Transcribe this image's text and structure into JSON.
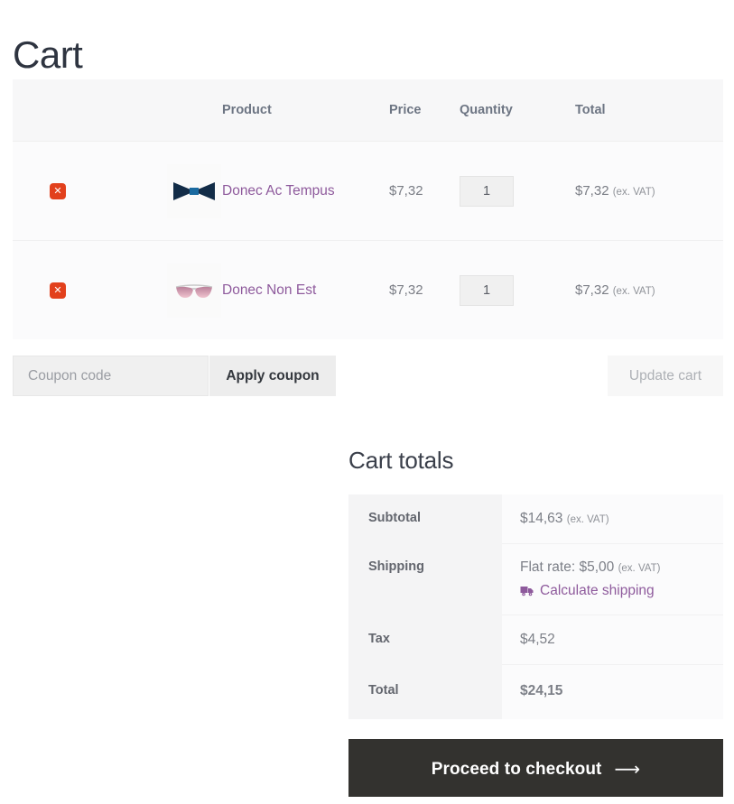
{
  "page": {
    "title": "Cart"
  },
  "cart_table": {
    "headers": {
      "remove": "",
      "thumbnail": "",
      "product": "Product",
      "price": "Price",
      "quantity": "Quantity",
      "total": "Total"
    },
    "rows": [
      {
        "remove_label": "✕",
        "thumbnail_icon": "bow-tie-thumbnail",
        "name": "Donec Ac Tempus",
        "price": "$7,32",
        "quantity": "1",
        "total": "$7,32",
        "total_suffix": "(ex. VAT)"
      },
      {
        "remove_label": "✕",
        "thumbnail_icon": "sunglasses-thumbnail",
        "name": "Donec Non Est",
        "price": "$7,32",
        "quantity": "1",
        "total": "$7,32",
        "total_suffix": "(ex. VAT)"
      }
    ]
  },
  "actions": {
    "coupon_placeholder": "Coupon code",
    "coupon_value": "",
    "apply_label": "Apply coupon",
    "update_label": "Update cart"
  },
  "totals": {
    "title": "Cart totals",
    "subtotal_label": "Subtotal",
    "subtotal_value": "$14,63",
    "subtotal_suffix": "(ex. VAT)",
    "shipping_label": "Shipping",
    "shipping_value": "Flat rate: $5,00",
    "shipping_suffix": "(ex. VAT)",
    "calculate_shipping_label": "Calculate shipping",
    "tax_label": "Tax",
    "tax_value": "$4,52",
    "total_label": "Total",
    "total_value": "$24,15"
  },
  "checkout": {
    "label": "Proceed to checkout",
    "arrow": "⟶"
  },
  "colors": {
    "link_purple": "#8e5a9c",
    "remove_red": "#e2401c",
    "checkout_dark": "#33322f",
    "header_text": "#6d7583",
    "title_text": "#2e3440"
  }
}
